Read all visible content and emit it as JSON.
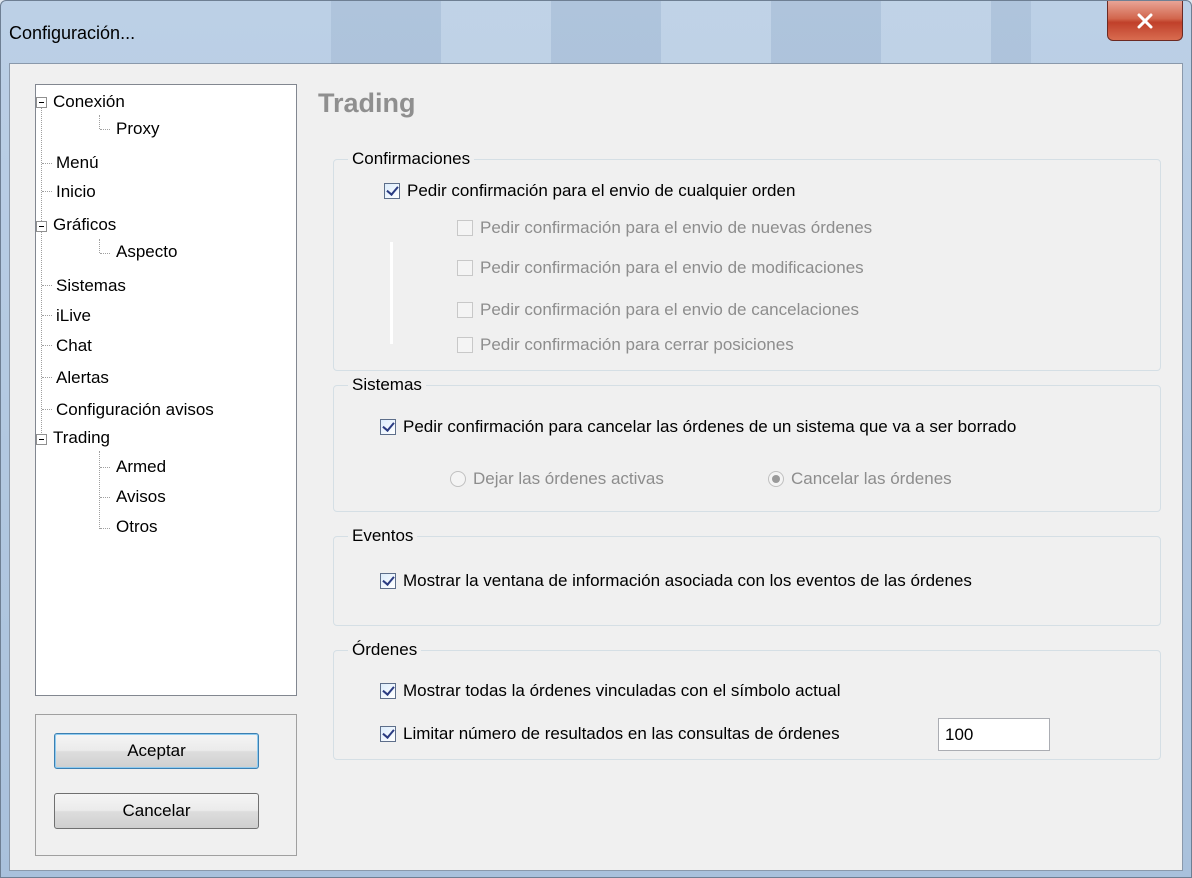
{
  "window": {
    "title": "Configuración..."
  },
  "tree": {
    "items": [
      {
        "label": "Conexión"
      },
      {
        "label": "Proxy"
      },
      {
        "label": "Menú"
      },
      {
        "label": "Inicio"
      },
      {
        "label": "Gráficos"
      },
      {
        "label": "Aspecto"
      },
      {
        "label": "Sistemas"
      },
      {
        "label": "iLive"
      },
      {
        "label": "Chat"
      },
      {
        "label": "Alertas"
      },
      {
        "label": "Configuración avisos"
      },
      {
        "label": "Trading"
      },
      {
        "label": "Armed"
      },
      {
        "label": "Avisos"
      },
      {
        "label": "Otros"
      }
    ]
  },
  "buttons": {
    "accept": "Aceptar",
    "cancel": "Cancelar"
  },
  "page": {
    "title": "Trading"
  },
  "confirmaciones": {
    "legend": "Confirmaciones",
    "main": "Pedir confirmación para el envio de cualquier orden",
    "new_orders": "Pedir confirmación para el envio de nuevas órdenes",
    "modifications": "Pedir confirmación para el envio de modificaciones",
    "cancellations": "Pedir confirmación para el envio de cancelaciones",
    "close_positions": "Pedir confirmación para cerrar posiciones"
  },
  "sistemas": {
    "legend": "Sistemas",
    "cancel_orders": "Pedir confirmación para cancelar las órdenes de un sistema que va a ser borrado",
    "leave_active": "Dejar las órdenes activas",
    "cancel": "Cancelar las órdenes"
  },
  "eventos": {
    "legend": "Eventos",
    "show_window": "Mostrar la ventana de información asociada con los eventos de las órdenes"
  },
  "ordenes": {
    "legend": "Órdenes",
    "show_linked": "Mostrar todas la órdenes vinculadas con el símbolo actual",
    "limit_results": "Limitar número de resultados en las consultas de órdenes",
    "limit_value": "100"
  }
}
